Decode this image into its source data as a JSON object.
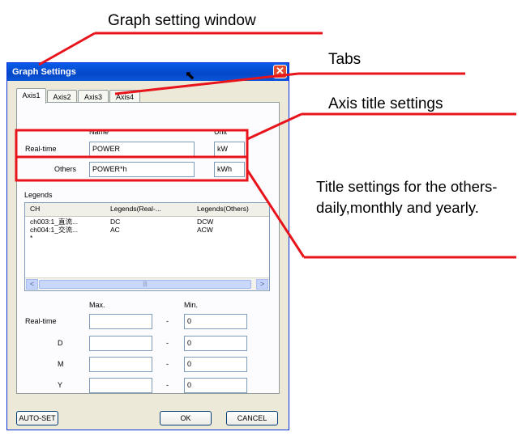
{
  "callouts": {
    "graph_setting_window": "Graph setting window",
    "tabs": "Tabs",
    "axis_title_settings": "Axis title settings",
    "others_title_settings": "Title settings for the others-daily,monthly and yearly."
  },
  "dialog": {
    "title": "Graph Settings",
    "tabs": [
      "Axis1",
      "Axis2",
      "Axis3",
      "Axis4"
    ],
    "axis_title": {
      "name_header": "Name",
      "unit_header": "Unit",
      "realtime_label": "Real-time",
      "realtime_name": "POWER",
      "realtime_unit": "kW",
      "others_label": "Others",
      "others_name": "POWER*h",
      "others_unit": "kWh"
    },
    "legends": {
      "label": "Legends",
      "columns": [
        "CH",
        "Legends(Real-...",
        "Legends(Others)"
      ],
      "rows": [
        [
          "ch003:1_直流...",
          "DC",
          "DCW"
        ],
        [
          "ch004:1_交流...",
          "AC",
          "ACW"
        ],
        [
          "*",
          "",
          ""
        ]
      ],
      "scroll_left": "<",
      "scroll_right": ">",
      "thumb_grip": "|||"
    },
    "range": {
      "max_header": "Max.",
      "min_header": "Min.",
      "separator": "-",
      "rows": [
        {
          "label": "Real-time",
          "max": "",
          "min": "0"
        },
        {
          "label": "D",
          "max": "",
          "min": "0"
        },
        {
          "label": "M",
          "max": "",
          "min": "0"
        },
        {
          "label": "Y",
          "max": "",
          "min": "0"
        }
      ]
    },
    "buttons": {
      "autoset": "AUTO-SET",
      "ok": "OK",
      "cancel": "CANCEL"
    },
    "close_symbol": "✕"
  },
  "colors": {
    "callout_line": "#e8141b",
    "title_bar": "#0a5ce8",
    "dialog_bg": "#ece9d8"
  }
}
